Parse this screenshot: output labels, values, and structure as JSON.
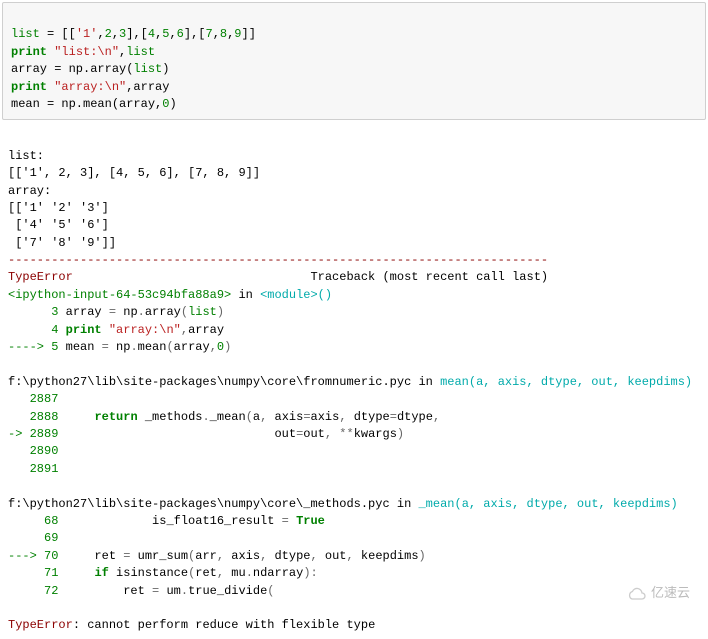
{
  "input": {
    "l1": {
      "t1": "list",
      "t2": " = [[",
      "t3": "'1'",
      "t4": ",",
      "t5": "2",
      "t6": ",",
      "t7": "3",
      "t8": "],[",
      "t9": "4",
      "t10": ",",
      "t11": "5",
      "t12": ",",
      "t13": "6",
      "t14": "],[",
      "t15": "7",
      "t16": ",",
      "t17": "8",
      "t18": ",",
      "t19": "9",
      "t20": "]]"
    },
    "l2": {
      "t1": "print",
      "t2": " ",
      "t3": "\"list:\\n\"",
      "t4": ",",
      "t5": "list"
    },
    "l3": {
      "t1": "array = np.array(",
      "t2": "list",
      "t3": ")"
    },
    "l4": {
      "t1": "print",
      "t2": " ",
      "t3": "\"array:\\n\"",
      "t4": ",array"
    },
    "l5": {
      "t1": "mean = np.mean(array,",
      "t2": "0",
      "t3": ")"
    }
  },
  "out": {
    "l1": "list:",
    "l2": "[['1', 2, 3], [4, 5, 6], [7, 8, 9]]",
    "l3": "array:",
    "l4": "[['1' '2' '3']",
    "l5": " ['4' '5' '6']",
    "l6": " ['7' '8' '9']]"
  },
  "trace": {
    "hr": "---------------------------------------------------------------------------",
    "err_name": "TypeError",
    "header_rest": "                                 Traceback (most recent call last)",
    "frame1": {
      "pre": "<ipython-input-64-53c94bfa88a9>",
      "in": " in ",
      "mod": "<module>",
      "post": "()"
    },
    "f1l3": {
      "num": "      3",
      "t1": " array ",
      "t2": "=",
      "t3": " np",
      "t4": ".",
      "t5": "array",
      "t6": "(",
      "t7": "list",
      "t8": ")"
    },
    "f1l4": {
      "num": "      4",
      "t1": " ",
      "t2": "print",
      "t3": " ",
      "t4": "\"array:\\n\"",
      "t5": ",",
      "t6": "array"
    },
    "f1l5": {
      "arrow": "----> 5",
      "t1": " mean ",
      "t2": "=",
      "t3": " np",
      "t4": ".",
      "t5": "mean",
      "t6": "(",
      "t7": "array",
      "t8": ",",
      "t9": "0",
      "t10": ")"
    },
    "frame2": {
      "path": "f:\\python27\\lib\\site-packages\\numpy\\core\\fromnumeric.pyc",
      "in": " in ",
      "func": "mean",
      "sig": "(a, axis, dtype, out, keepdims)"
    },
    "f2l2887": {
      "num": "   2887"
    },
    "f2l2888": {
      "num": "   2888",
      "t1": "     ",
      "t2": "return",
      "t3": " _methods",
      "t4": ".",
      "t5": "_mean",
      "t6": "(",
      "t7": "a",
      "t8": ",",
      "t9": " axis",
      "t10": "=",
      "t11": "axis",
      "t12": ",",
      "t13": " dtype",
      "t14": "=",
      "t15": "dtype",
      "t16": ","
    },
    "f2l2889": {
      "arrow": "-> 2889",
      "t1": "                              out",
      "t2": "=",
      "t3": "out",
      "t4": ",",
      "t5": " ",
      "t6": "**",
      "t7": "kwargs",
      "t8": ")"
    },
    "f2l2890": {
      "num": "   2890"
    },
    "f2l2891": {
      "num": "   2891"
    },
    "frame3": {
      "path": "f:\\python27\\lib\\site-packages\\numpy\\core\\_methods.pyc",
      "in": " in ",
      "func": "_mean",
      "sig": "(a, axis, dtype, out, keepdims)"
    },
    "f3l68": {
      "num": "     68",
      "t1": "             is_float16_result ",
      "t2": "=",
      "t3": " ",
      "t4": "True"
    },
    "f3l69": {
      "num": "     69"
    },
    "f3l70": {
      "arrow": "---> 70",
      "t1": "     ret ",
      "t2": "=",
      "t3": " umr_sum",
      "t4": "(",
      "t5": "arr",
      "t6": ",",
      "t7": " axis",
      "t8": ",",
      "t9": " dtype",
      "t10": ",",
      "t11": " out",
      "t12": ",",
      "t13": " keepdims",
      "t14": ")"
    },
    "f3l71": {
      "num": "     71",
      "t1": "     ",
      "t2": "if",
      "t3": " isinstance",
      "t4": "(",
      "t5": "ret",
      "t6": ",",
      "t7": " mu",
      "t8": ".",
      "t9": "ndarray",
      "t10": ")",
      "t11": ":"
    },
    "f3l72": {
      "num": "     72",
      "t1": "         ret ",
      "t2": "=",
      "t3": " um",
      "t4": ".",
      "t5": "true_divide",
      "t6": "("
    },
    "final": {
      "name": "TypeError",
      "colon": ": ",
      "msg": "cannot perform reduce with flexible type"
    }
  },
  "watermark": "亿速云"
}
